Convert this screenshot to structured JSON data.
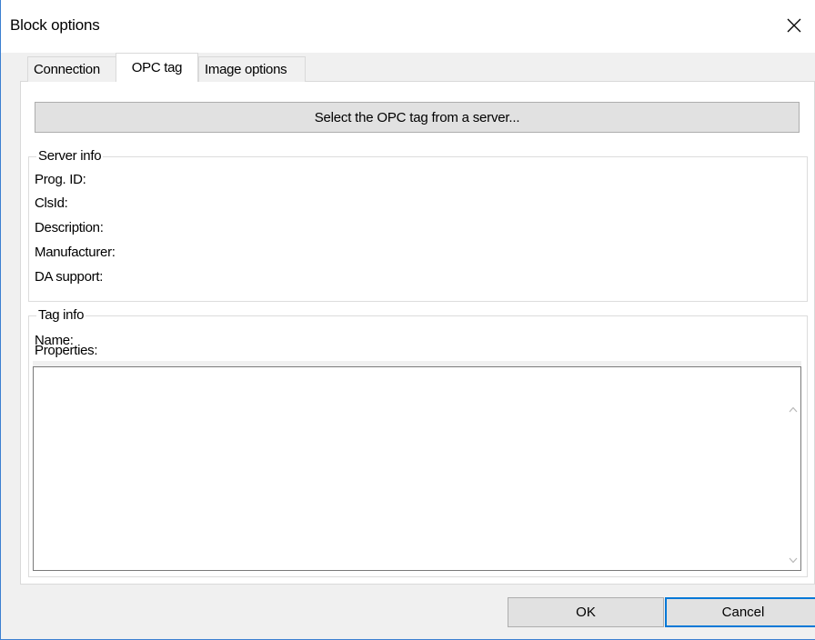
{
  "window": {
    "title": "Block options",
    "close_icon": "close-icon"
  },
  "tabs": [
    {
      "label": "Connection",
      "active": false
    },
    {
      "label": "OPC tag",
      "active": true
    },
    {
      "label": "Image options",
      "active": false
    }
  ],
  "opc_tag": {
    "select_button_label": "Select the OPC tag from a server...",
    "server_info": {
      "legend": "Server info",
      "fields": [
        "Prog. ID:",
        "ClsId:",
        "Description:",
        "Manufacturer:",
        "DA support:"
      ]
    },
    "tag_info": {
      "legend": "Tag info",
      "name_label": "Name:",
      "properties_label": "Properties:",
      "properties_value": ""
    }
  },
  "buttons": {
    "ok": "OK",
    "cancel": "Cancel"
  },
  "colors": {
    "accent": "#0078d7",
    "window_border": "#3b7fd1"
  }
}
